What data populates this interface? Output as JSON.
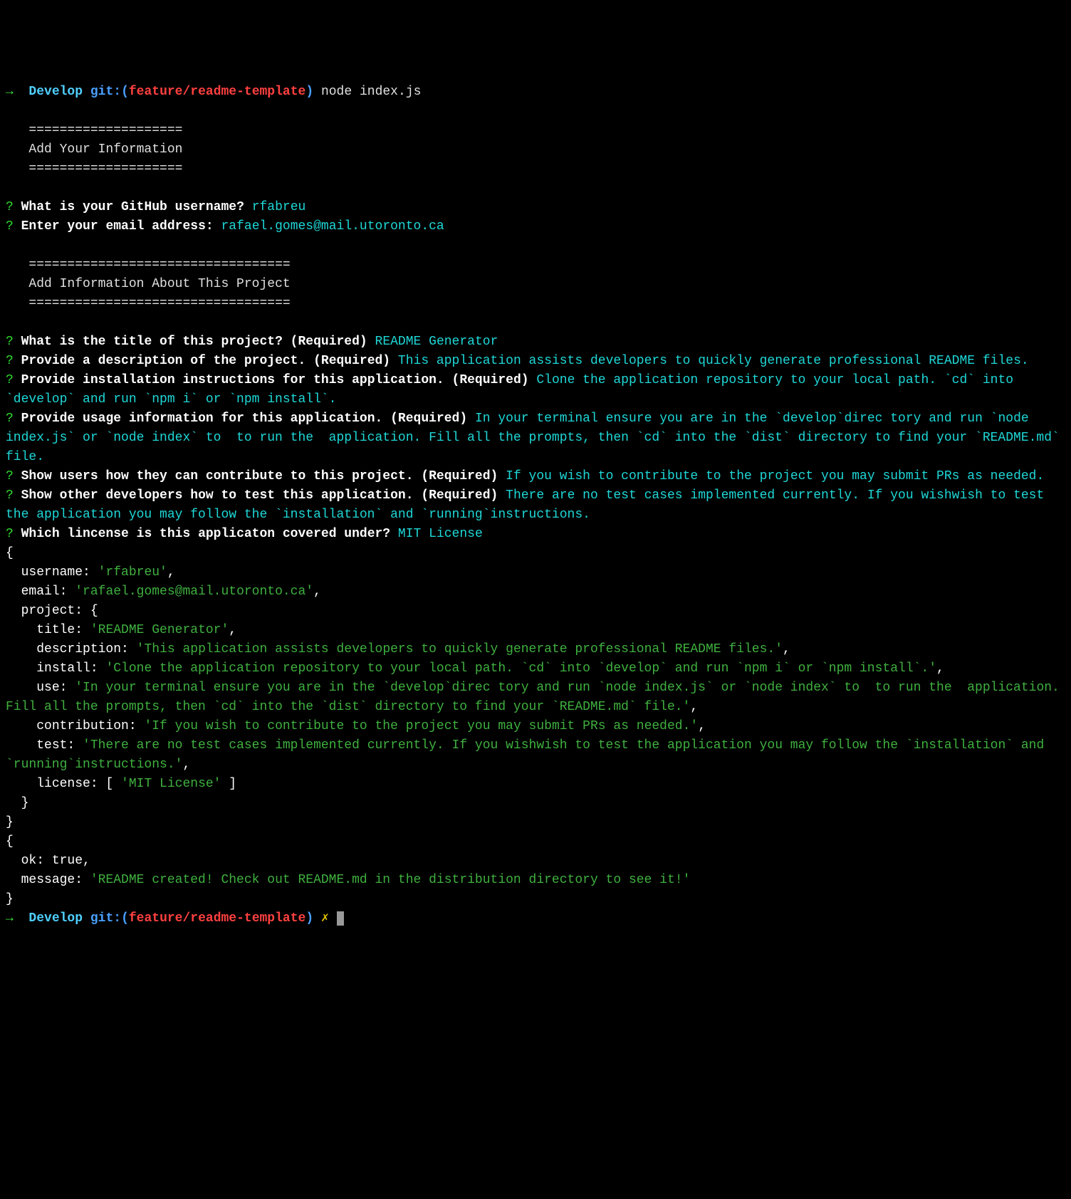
{
  "prompt1": {
    "arrow": "→",
    "dir": "Develop",
    "git_prefix": "git:(",
    "branch": "feature/readme-template",
    "git_suffix": ")",
    "command": "node index.js"
  },
  "section1": {
    "sep": "====================",
    "title": "Add Your Information"
  },
  "q1": {
    "mark": "?",
    "text": "What is your GitHub username?",
    "answer": "rfabreu"
  },
  "q2": {
    "mark": "?",
    "text": "Enter your email address:",
    "answer": "rafael.gomes@mail.utoronto.ca"
  },
  "section2": {
    "sep": "==================================",
    "title": "Add Information About This Project"
  },
  "q3": {
    "mark": "?",
    "text": "What is the title of this project? (Required)",
    "answer": "README Generator"
  },
  "q4": {
    "mark": "?",
    "text": "Provide a description of the project. (Required)",
    "answer": "This application assists developers to quickly generate professional README files."
  },
  "q5": {
    "mark": "?",
    "text": "Provide installation instructions for this application. (Required)",
    "answer": "Clone the application repository to your local path. `cd` into `develop` and run `npm i` or `npm install`."
  },
  "q6": {
    "mark": "?",
    "text": "Provide usage information for this application. (Required)",
    "answer": "In your terminal ensure you are in the `develop`direc tory and run `node index.js` or `node index` to  to run the  application. Fill all the prompts, then `cd` into the `dist` directory to find your `README.md` file."
  },
  "q7": {
    "mark": "?",
    "text": "Show users how they can contribute to this project. (Required)",
    "answer": "If you wish to contribute to the project you may submit PRs as needed."
  },
  "q8": {
    "mark": "?",
    "text": "Show other developers how to test this application. (Required)",
    "answer": "There are no test cases implemented currently. If you wishwish to test the application you may follow the `installation` and `running`instructions."
  },
  "q9": {
    "mark": "?",
    "text": "Which lincense is this applicaton covered under?",
    "answer": "MIT License"
  },
  "obj1": {
    "open": "{",
    "l1_key": "  username: ",
    "l1_val": "'rfabreu'",
    "l1_end": ",",
    "l2_key": "  email: ",
    "l2_val": "'rafael.gomes@mail.utoronto.ca'",
    "l2_end": ",",
    "l3": "  project: {",
    "l4_key": "    title: ",
    "l4_val": "'README Generator'",
    "l4_end": ",",
    "l5_key": "    description: ",
    "l5_val": "'This application assists developers to quickly generate professional README files.'",
    "l5_end": ",",
    "l6_key": "    install: ",
    "l6_val": "'Clone the application repository to your local path. `cd` into `develop` and run `npm i` or `npm install`.'",
    "l6_end": ",",
    "l7_key": "    use: ",
    "l7_val": "'In your terminal ensure you are in the `develop`direc tory and run `node index.js` or `node index` to  to run the  application. Fill all the prompts, then `cd` into the `dist` directory to find your `README.md` file.'",
    "l7_end": ",",
    "l8_key": "    contribution: ",
    "l8_val": "'If you wish to contribute to the project you may submit PRs as needed.'",
    "l8_end": ",",
    "l9_key": "    test: ",
    "l9_val": "'There are no test cases implemented currently. If you wishwish to test the application you may follow the `installation` and `running`instructions.'",
    "l9_end": ",",
    "l10_key": "    license: [ ",
    "l10_val": "'MIT License'",
    "l10_end": " ]",
    "l11": "  }",
    "close": "}"
  },
  "obj2": {
    "open": "{",
    "l1": "  ok: true,",
    "l2_key": "  message: ",
    "l2_val": "'README created! Check out README.md in the distribution directory to see it!'",
    "close": "}"
  },
  "prompt2": {
    "arrow": "→",
    "dir": "Develop",
    "git_prefix": "git:(",
    "branch": "feature/readme-template",
    "git_suffix": ")",
    "dirty": "✗"
  }
}
